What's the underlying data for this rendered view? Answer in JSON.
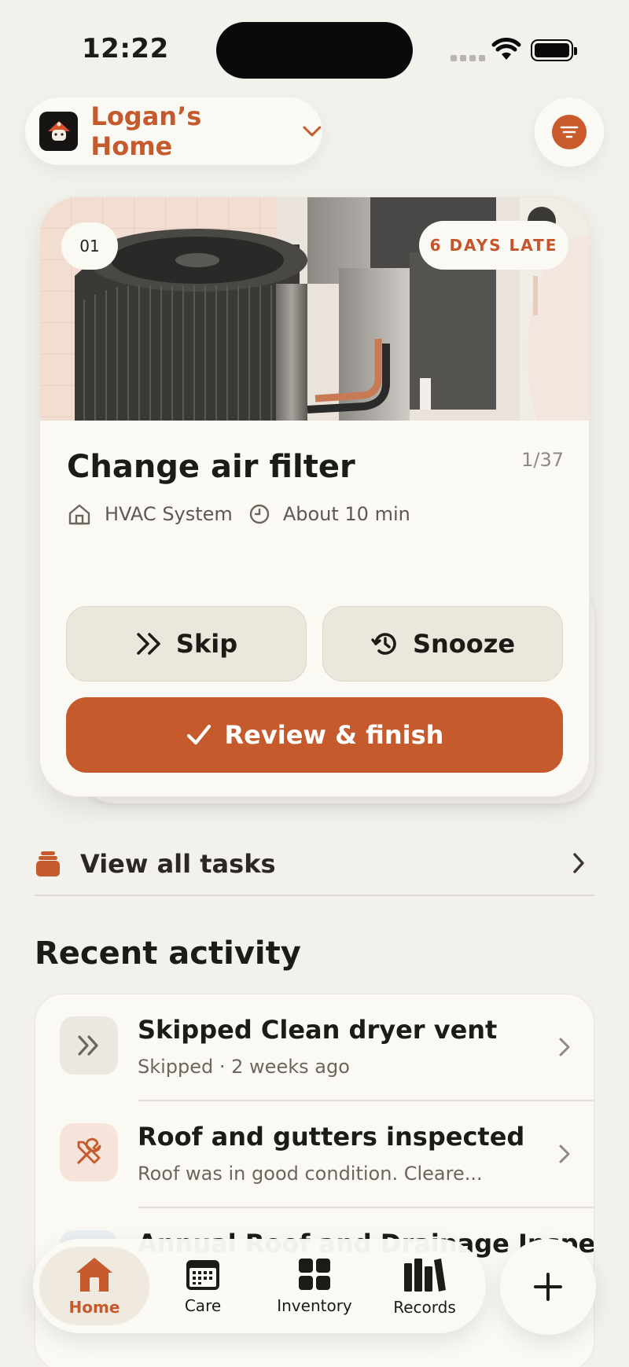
{
  "status_bar": {
    "time": "12:22"
  },
  "home_switcher": {
    "name": "Logan’s Home"
  },
  "task_card": {
    "number": "01",
    "late_badge": "6 DAYS LATE",
    "title": "Change air filter",
    "position": "1/37",
    "category": "HVAC System",
    "duration": "About 10 min",
    "skip_label": "Skip",
    "snooze_label": "Snooze",
    "finish_label": "Review & finish"
  },
  "view_all": {
    "label": "View all tasks"
  },
  "recent_activity": {
    "title": "Recent activity",
    "items": [
      {
        "title": "Skipped Clean dryer vent",
        "subtitle": "Skipped · 2 weeks ago",
        "icon": "skip-icon"
      },
      {
        "title": "Roof and gutters inspected",
        "subtitle": "Roof was in good condition. Cleare...",
        "icon": "tools-icon"
      },
      {
        "title": "Annual Roof and Drainage Inspection Report",
        "subtitle": "",
        "icon": "document-icon"
      }
    ]
  },
  "tab_bar": {
    "tabs": [
      {
        "label": "Home",
        "icon": "home-icon",
        "active": true
      },
      {
        "label": "Care",
        "icon": "calendar-icon"
      },
      {
        "label": "Inventory",
        "icon": "grid-icon"
      },
      {
        "label": "Records",
        "icon": "books-icon"
      }
    ],
    "add_icon": "plus-icon"
  },
  "colors": {
    "accent": "#c55a2d",
    "background": "#f3f1ec",
    "card": "#fbf9f4"
  }
}
